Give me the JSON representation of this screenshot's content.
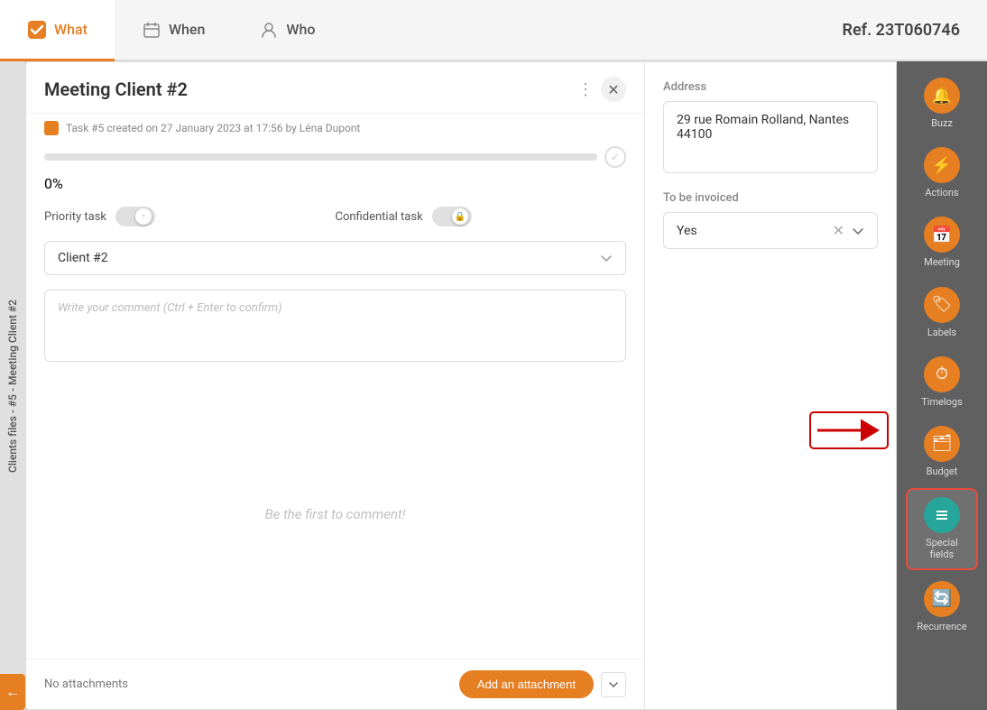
{
  "tabs": [
    {
      "id": "what",
      "label": "What",
      "icon": "✓",
      "active": true
    },
    {
      "id": "when",
      "label": "When",
      "icon": "📅"
    },
    {
      "id": "who",
      "label": "Who",
      "icon": "👤"
    }
  ],
  "ref": "Ref. 23T060746",
  "modal": {
    "title": "Meeting Client #2",
    "task_info": "Task #5 created on 27 January 2023 at 17:56 by Léna Dupont",
    "progress_percent": "0%",
    "progress_value": 0,
    "priority_task_label": "Priority task",
    "confidential_task_label": "Confidential task",
    "client_dropdown": "Client #2",
    "comment_placeholder": "Write your comment (Ctrl + Enter to confirm)",
    "be_first_comment": "Be the first to comment!",
    "no_attachments": "No attachments",
    "add_attachment_label": "Add an attachment"
  },
  "right_panel": {
    "address_label": "Address",
    "address_value": "29 rue Romain Rolland, Nantes 44100",
    "invoice_label": "To be invoiced",
    "invoice_value": "Yes"
  },
  "sidebar": {
    "items": [
      {
        "id": "buzz",
        "label": "Buzz",
        "icon": "🔔",
        "color": "orange"
      },
      {
        "id": "actions",
        "label": "Actions",
        "icon": "⚡",
        "color": "orange"
      },
      {
        "id": "meeting",
        "label": "Meeting",
        "icon": "📅",
        "color": "orange"
      },
      {
        "id": "labels",
        "label": "Labels",
        "icon": "🏷",
        "color": "orange"
      },
      {
        "id": "timelogs",
        "label": "Timelogs",
        "icon": "⏱",
        "color": "orange"
      },
      {
        "id": "budget",
        "label": "Budget",
        "icon": "🗂",
        "color": "orange"
      },
      {
        "id": "special-fields",
        "label": "Special fields",
        "icon": "☰",
        "color": "teal",
        "active": true
      },
      {
        "id": "recurrence",
        "label": "Recurrence",
        "icon": "🔄",
        "color": "orange"
      }
    ]
  },
  "side_label_text": "Clients files - #5 - Meeting Client #2"
}
